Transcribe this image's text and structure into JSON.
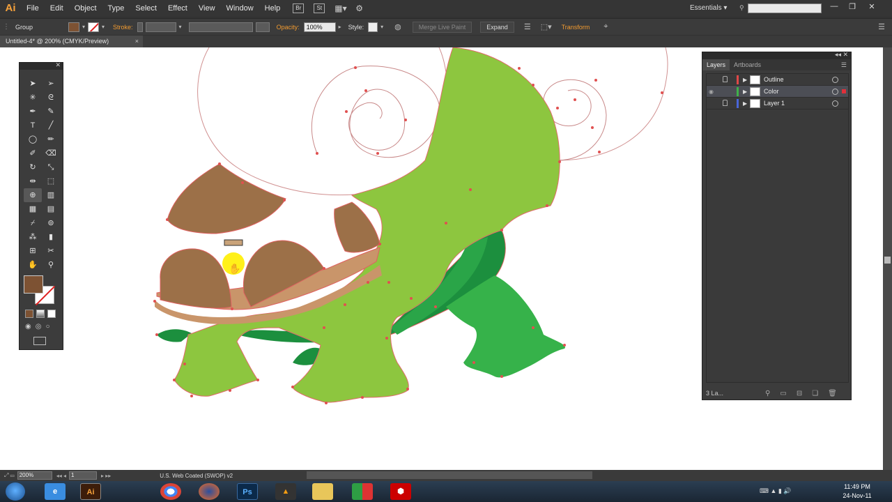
{
  "app": {
    "logo": "Ai"
  },
  "menu": [
    "File",
    "Edit",
    "Object",
    "Type",
    "Select",
    "Effect",
    "View",
    "Window",
    "Help"
  ],
  "menubar": {
    "bridge": "Br",
    "stock": "St",
    "workspace": "Essentials",
    "search_placeholder": ""
  },
  "control_bar": {
    "selection_label": "Group",
    "fill_color": "#7d5233",
    "stroke_label": "Stroke:",
    "opacity_label": "Opacity:",
    "opacity_value": "100%",
    "style_label": "Style:",
    "merge_live_paint": "Merge Live Paint",
    "expand": "Expand",
    "transform": "Transform"
  },
  "document_tab": {
    "title": "Untitled-4* @ 200% (CMYK/Preview)",
    "close": "×"
  },
  "tools": {
    "fill_color": "#7d5233",
    "items": [
      {
        "name": "selection-tool-icon",
        "glyph": "➤"
      },
      {
        "name": "direct-selection-tool-icon",
        "glyph": "➢"
      },
      {
        "name": "magic-wand-tool-icon",
        "glyph": "✳"
      },
      {
        "name": "lasso-tool-icon",
        "glyph": "ᘓ"
      },
      {
        "name": "pen-tool-icon",
        "glyph": "✒"
      },
      {
        "name": "curvature-tool-icon",
        "glyph": "✎"
      },
      {
        "name": "type-tool-icon",
        "glyph": "T"
      },
      {
        "name": "line-tool-icon",
        "glyph": "╱"
      },
      {
        "name": "ellipse-tool-icon",
        "glyph": "◯"
      },
      {
        "name": "paintbrush-tool-icon",
        "glyph": "✏"
      },
      {
        "name": "pencil-tool-icon",
        "glyph": "✐"
      },
      {
        "name": "eraser-tool-icon",
        "glyph": "⌫"
      },
      {
        "name": "rotate-tool-icon",
        "glyph": "↻"
      },
      {
        "name": "scale-tool-icon",
        "glyph": "⤡"
      },
      {
        "name": "width-tool-icon",
        "glyph": "⇹"
      },
      {
        "name": "free-transform-tool-icon",
        "glyph": "⬚"
      },
      {
        "name": "shape-builder-tool-icon",
        "glyph": "⊕"
      },
      {
        "name": "chart-tool-icon",
        "glyph": "▥"
      },
      {
        "name": "mesh-tool-icon",
        "glyph": "▦"
      },
      {
        "name": "gradient-tool-icon",
        "glyph": "▤"
      },
      {
        "name": "eyedropper-tool-icon",
        "glyph": "⌿"
      },
      {
        "name": "blend-tool-icon",
        "glyph": "⊚"
      },
      {
        "name": "symbol-sprayer-tool-icon",
        "glyph": "⁂"
      },
      {
        "name": "column-graph-tool-icon",
        "glyph": "▮"
      },
      {
        "name": "artboard-tool-icon",
        "glyph": "⊞"
      },
      {
        "name": "slice-tool-icon",
        "glyph": "✂"
      },
      {
        "name": "hand-tool-icon",
        "glyph": "✋"
      },
      {
        "name": "zoom-tool-icon",
        "glyph": "⚲"
      }
    ]
  },
  "layers_panel": {
    "tabs": [
      "Layers",
      "Artboards"
    ],
    "layers": [
      {
        "name": "Outline",
        "color": "#e04848",
        "selected": false,
        "locked": true,
        "visible": false
      },
      {
        "name": "Color",
        "color": "#3fb24a",
        "selected": true,
        "locked": false,
        "visible": true
      },
      {
        "name": "Layer 1",
        "color": "#4a66d8",
        "selected": false,
        "locked": true,
        "visible": false
      }
    ],
    "count_label": "3 La..."
  },
  "status_bar": {
    "zoom": "200%",
    "artboard": "1",
    "profile": "U.S. Web Coated (SWOP) v2"
  },
  "taskbar": {
    "apps": [
      "Ai",
      "Ps"
    ],
    "time": "11:49 PM",
    "date": "24-Nov-11"
  }
}
